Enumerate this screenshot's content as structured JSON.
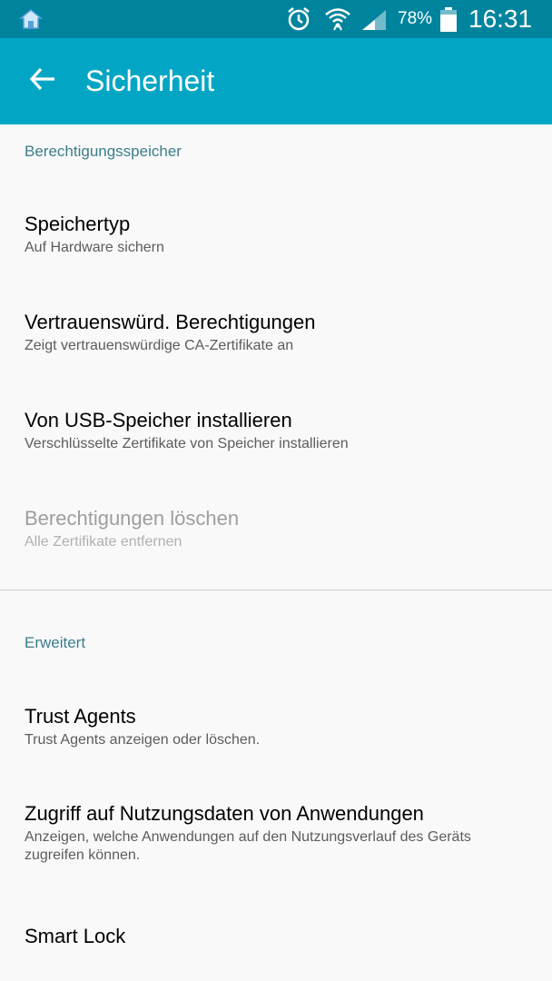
{
  "status_bar": {
    "battery_percent": "78%",
    "time": "16:31",
    "icons": [
      "home-icon",
      "alarm-icon",
      "wifi-icon",
      "signal-icon",
      "battery-icon"
    ]
  },
  "app_bar": {
    "title": "Sicherheit",
    "back_icon": "arrow-left-icon"
  },
  "colors": {
    "status_bar_bg": "#00849e",
    "app_bar_bg": "#02a6c4",
    "section_header": "#3b7d8c",
    "background": "#f9f9f9"
  },
  "sections": [
    {
      "header": "Berechtigungsspeicher",
      "items": [
        {
          "title": "Speichertyp",
          "subtitle": "Auf Hardware sichern",
          "enabled": true
        },
        {
          "title": "Vertrauenswürd. Berechtigungen",
          "subtitle": "Zeigt vertrauenswürdige CA-Zertifikate an",
          "enabled": true
        },
        {
          "title": "Von USB-Speicher installieren",
          "subtitle": "Verschlüsselte Zertifikate von Speicher installieren",
          "enabled": true
        },
        {
          "title": "Berechtigungen löschen",
          "subtitle": "Alle Zertifikate entfernen",
          "enabled": false
        }
      ]
    },
    {
      "header": "Erweitert",
      "items": [
        {
          "title": "Trust Agents",
          "subtitle": "Trust Agents anzeigen oder löschen.",
          "enabled": true
        },
        {
          "title": "Zugriff auf Nutzungsdaten von Anwendungen",
          "subtitle": "Anzeigen, welche Anwendungen auf den Nutzungsverlauf des Geräts zugreifen können.",
          "enabled": true
        },
        {
          "title": "Smart Lock",
          "subtitle": "",
          "enabled": true
        }
      ]
    }
  ]
}
